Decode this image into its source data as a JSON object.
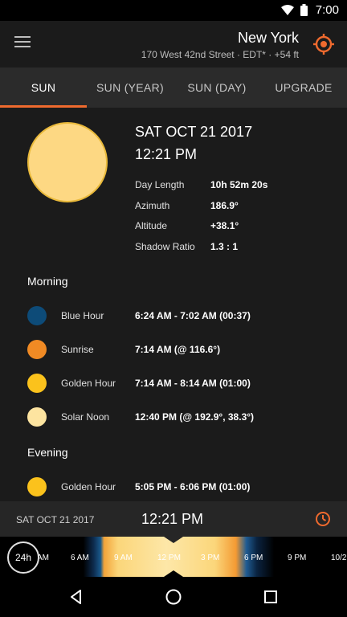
{
  "status_bar": {
    "time": "7:00"
  },
  "header": {
    "location_name": "New York",
    "location_details": "170 West 42nd Street · EDT* · +54 ft"
  },
  "tabs": [
    {
      "label": "SUN",
      "active": true
    },
    {
      "label": "SUN (YEAR)",
      "active": false
    },
    {
      "label": "SUN (DAY)",
      "active": false
    },
    {
      "label": "UPGRADE",
      "active": false
    }
  ],
  "summary": {
    "date": "SAT OCT 21 2017",
    "time": "12:21 PM",
    "rows": [
      {
        "label": "Day Length",
        "value": "10h 52m 20s"
      },
      {
        "label": "Azimuth",
        "value": "186.9°"
      },
      {
        "label": "Altitude",
        "value": "+38.1°"
      },
      {
        "label": "Shadow Ratio",
        "value": "1.3 : 1"
      }
    ]
  },
  "morning": {
    "title": "Morning",
    "events": [
      {
        "name": "Blue Hour",
        "time": "6:24 AM - 7:02 AM  (00:37)",
        "color": "#0d4b78"
      },
      {
        "name": "Sunrise",
        "time": "7:14 AM (@ 116.6°)",
        "color": "#f08a24"
      },
      {
        "name": "Golden Hour",
        "time": "7:14 AM - 8:14 AM  (01:00)",
        "color": "#fbc21c"
      },
      {
        "name": "Solar Noon",
        "time": "12:40 PM (@ 192.9°, 38.3°)",
        "color": "#fde4a0"
      }
    ]
  },
  "evening": {
    "title": "Evening",
    "events": [
      {
        "name": "Golden Hour",
        "time": "5:05 PM - 6:06 PM  (01:00)",
        "color": "#fbc21c"
      }
    ]
  },
  "bottom_bar": {
    "date": "SAT OCT 21 2017",
    "time": "12:21 PM"
  },
  "timeline": {
    "range_label": "24h",
    "ticks": [
      "AM",
      "6 AM",
      "9 AM",
      "12 PM",
      "3 PM",
      "6 PM",
      "9 PM",
      "10/2"
    ]
  },
  "colors": {
    "accent": "#ef6a2e",
    "sun_fill": "#fdd883"
  }
}
